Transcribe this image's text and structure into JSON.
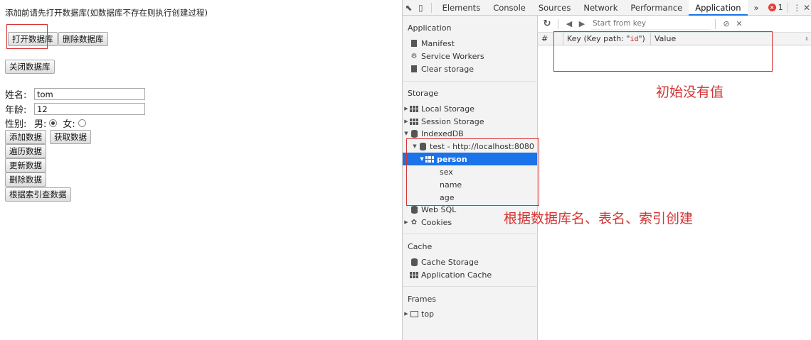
{
  "page": {
    "intro_text": "添加前请先打开数据库(如数据库不存在则执行创建过程)",
    "buttons": {
      "open_db": "打开数据库",
      "delete_db": "删除数据库",
      "close_db": "关闭数据库",
      "add_data": "添加数据",
      "get_data": "获取数据",
      "iterate_data": "遍历数据",
      "update_data": "更新数据",
      "delete_data": "删除数据",
      "query_by_index": "根据索引查数据"
    },
    "form": {
      "name_label": "姓名:",
      "name_value": "tom",
      "age_label": "年龄:",
      "age_value": "12",
      "gender_label": "性别:",
      "male_label": "男:",
      "female_label": "女:",
      "male_checked": true,
      "female_checked": false
    }
  },
  "annotations": {
    "no_value": "初始没有值",
    "created_by": "根据数据库名、表名、索引创建"
  },
  "devtools": {
    "tabs": [
      "Elements",
      "Console",
      "Sources",
      "Network",
      "Performance",
      "Application"
    ],
    "active_tab": "Application",
    "more_tabs": "»",
    "error_count": "1",
    "sidebar": {
      "application_title": "Application",
      "application_items": [
        "Manifest",
        "Service Workers",
        "Clear storage"
      ],
      "storage_title": "Storage",
      "local_storage": "Local Storage",
      "session_storage": "Session Storage",
      "indexeddb": "IndexedDB",
      "db_entry": "test - http://localhost:8080",
      "store_entry": "person",
      "indexes": [
        "sex",
        "name",
        "age"
      ],
      "web_sql": "Web SQL",
      "cookies": "Cookies",
      "cache_title": "Cache",
      "cache_storage": "Cache Storage",
      "application_cache": "Application Cache",
      "frames_title": "Frames",
      "frame_top": "top"
    },
    "main": {
      "start_key_placeholder": "Start from key",
      "columns": {
        "index": "#",
        "key_prefix": "Key (Key path: \"",
        "key_path": "id",
        "key_suffix": "\")",
        "value": "Value"
      }
    }
  },
  "colors": {
    "annotation_red": "#d43434",
    "selected_blue": "#1a73e8",
    "devtools_bg": "#f3f3f3"
  }
}
